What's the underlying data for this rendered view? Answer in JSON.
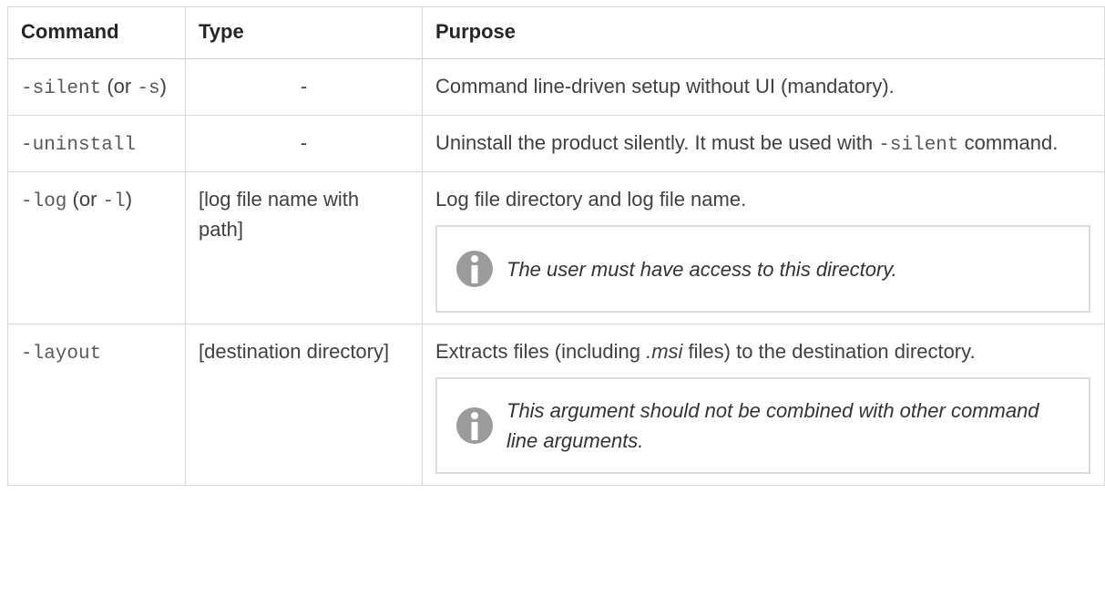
{
  "table": {
    "headers": {
      "command": "Command",
      "type": "Type",
      "purpose": "Purpose"
    },
    "rows": [
      {
        "cmd_flag": "-silent",
        "cmd_or_open": " (or ",
        "cmd_alt": "-s",
        "cmd_close": ")",
        "type": "-",
        "purpose": "Command line-driven setup without UI (mandatory)."
      },
      {
        "cmd_flag": "-uninstall",
        "type": "-",
        "purpose_pre": "Uninstall the product silently. It must be used with ",
        "purpose_code": "-silent",
        "purpose_post": " command."
      },
      {
        "cmd_flag": "-log",
        "cmd_or_open": " (or ",
        "cmd_alt": "-l",
        "cmd_close": ")",
        "type": "[log file name with path]",
        "purpose": "Log file directory and log file name.",
        "note": "The user must have access to this directory."
      },
      {
        "cmd_flag": "-layout",
        "type": "[destination directory]",
        "purpose_pre": "Extracts files (including ",
        "purpose_ital": ".msi",
        "purpose_post": " files) to the destination directory.",
        "note": "This argument should not be combined with other command line arguments."
      }
    ]
  },
  "icons": {
    "note_icon": "info-icon",
    "note_icon_color": "#9b9b9b"
  }
}
